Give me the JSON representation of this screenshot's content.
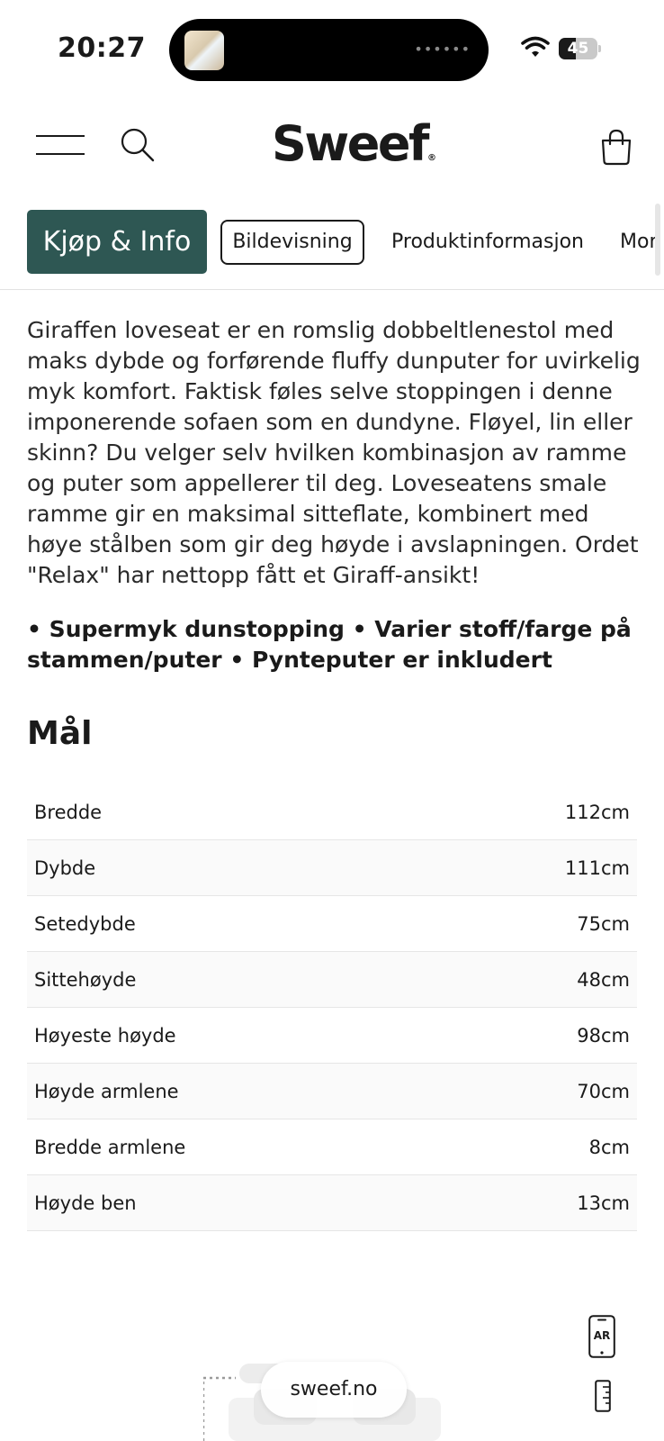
{
  "status_bar": {
    "time": "20:27",
    "battery": "45",
    "battery_level": 0.45
  },
  "header": {
    "logo": "Sweef",
    "logo_mark": "®",
    "icons": [
      "menu-icon",
      "search-icon",
      "shopping-bag-icon"
    ]
  },
  "tabs": [
    {
      "label": "Kjøp & Info",
      "style": "selected"
    },
    {
      "label": "Bildevisning",
      "style": "outlined"
    },
    {
      "label": "Produktinformasjon",
      "style": "plain"
    },
    {
      "label": "Mon",
      "style": "plain"
    }
  ],
  "description": "Giraffen loveseat er en romslig dobbeltlenestol med maks dybde og forførende fluffy dunputer for uvirkelig myk komfort. Faktisk føles selve stoppingen i denne imponerende sofaen som en dundyne. Fløyel, lin eller skinn? Du velger selv hvilken kombinasjon av ramme og puter som appellerer til deg. Loveseatens smale ramme gir en maksimal sitteflate, kombinert med høye stålben som gir deg høyde i avslapningen. Ordet \"Relax\" har nettopp fått et Giraff-ansikt!",
  "highlights": "• Supermyk dunstopping • Varier stoff/farge på stammen/puter • Pynteputer er inkludert",
  "dimensions": {
    "title": "Mål",
    "rows": [
      {
        "label": "Bredde",
        "value": "112cm"
      },
      {
        "label": "Dybde",
        "value": "111cm"
      },
      {
        "label": "Setedybde",
        "value": "75cm"
      },
      {
        "label": "Sittehøyde",
        "value": "48cm"
      },
      {
        "label": "Høyeste høyde",
        "value": "98cm"
      },
      {
        "label": "Høyde armlene",
        "value": "70cm"
      },
      {
        "label": "Bredde armlene",
        "value": "8cm"
      },
      {
        "label": "Høyde ben",
        "value": "13cm"
      }
    ]
  },
  "bottom": {
    "ar_label": "AR",
    "url": "sweef.no"
  },
  "colors": {
    "accent": "#2e5753",
    "text": "#1a1a1a",
    "border": "#e6e6e6"
  }
}
